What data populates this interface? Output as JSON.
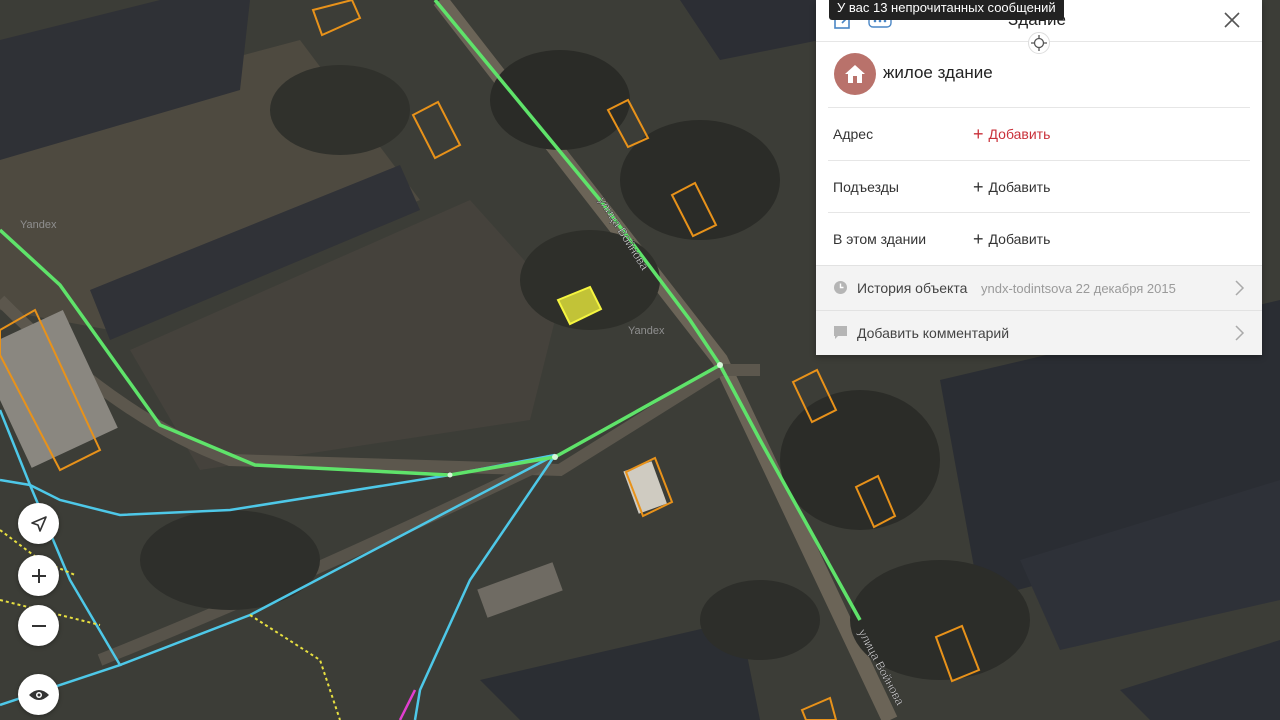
{
  "map": {
    "street_label_1": "улица Войнова",
    "street_label_2": "улица Войнова",
    "watermark_1": "Yandex",
    "watermark_2": "Yandex"
  },
  "map_controls": {
    "locate": "location-arrow-icon",
    "zoom_in": "plus-icon",
    "zoom_out": "minus-icon",
    "layers": "eye-icon"
  },
  "notification": {
    "text": "У вас 13 непрочитанных сообщений"
  },
  "panel": {
    "title": "Здание",
    "building_type": "жилое здание",
    "rows": [
      {
        "label": "Адрес",
        "action": "Добавить",
        "accent": true
      },
      {
        "label": "Подъезды",
        "action": "Добавить",
        "accent": false
      },
      {
        "label": "В этом здании",
        "action": "Добавить",
        "accent": false
      }
    ],
    "history": {
      "label": "История объекта",
      "meta": "yndx-todintsova 22 декабря 2015"
    },
    "comment": {
      "label": "Добавить комментарий"
    }
  },
  "colors": {
    "accent_red": "#c9313a",
    "road_green": "#5fe36a",
    "path_cyan": "#4ec8e8",
    "building_outline": "#e8921a",
    "selected_building": "#f2f23a",
    "building_icon_bg": "#b9726b"
  }
}
